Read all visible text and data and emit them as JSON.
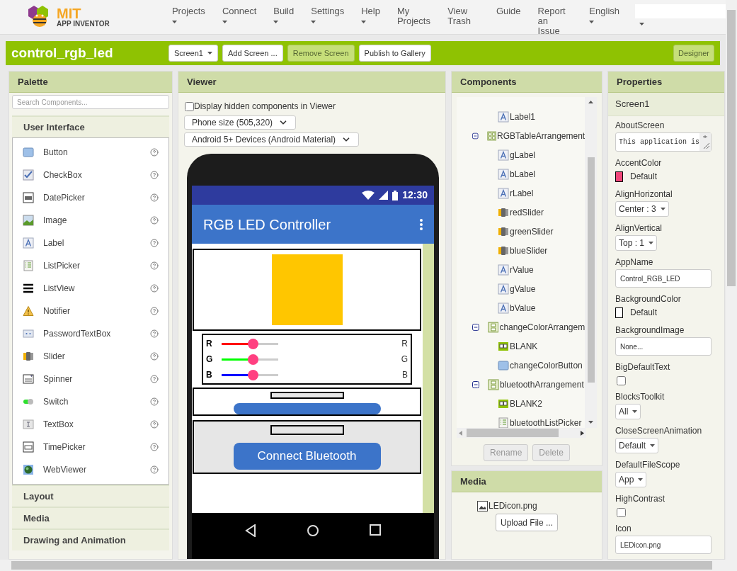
{
  "header": {
    "logo_title": "MIT",
    "logo_subtitle": "APP INVENTOR",
    "nav": [
      {
        "label": "Projects",
        "menu": true
      },
      {
        "label": "Connect",
        "menu": true
      },
      {
        "label": "Build",
        "menu": true
      },
      {
        "label": "Settings",
        "menu": true
      },
      {
        "label": "Help",
        "menu": true
      },
      {
        "label": "My Projects",
        "menu": false
      },
      {
        "label": "View Trash",
        "menu": false
      },
      {
        "label": "Guide",
        "menu": false
      },
      {
        "label": "Report an Issue",
        "menu": false
      },
      {
        "label": "English",
        "menu": true
      }
    ]
  },
  "toolbar": {
    "project": "control_rgb_led",
    "screen": "Screen1",
    "buttons": [
      {
        "label": "Add Screen ...",
        "disabled": false
      },
      {
        "label": "Remove Screen",
        "disabled": true
      },
      {
        "label": "Publish to Gallery",
        "disabled": false
      }
    ],
    "designer": {
      "label": "Designer",
      "selected": true
    }
  },
  "palette": {
    "title": "Palette",
    "search_placeholder": "Search Components...",
    "categories": [
      {
        "label": "User Interface",
        "items": [
          {
            "label": "Button",
            "kind": "button"
          },
          {
            "label": "CheckBox",
            "kind": "checkbox"
          },
          {
            "label": "DatePicker",
            "kind": "datepicker"
          },
          {
            "label": "Image",
            "kind": "image"
          },
          {
            "label": "Label",
            "kind": "label"
          },
          {
            "label": "ListPicker",
            "kind": "listpicker"
          },
          {
            "label": "ListView",
            "kind": "listview"
          },
          {
            "label": "Notifier",
            "kind": "notifier"
          },
          {
            "label": "PasswordTextBox",
            "kind": "password"
          },
          {
            "label": "Slider",
            "kind": "slider"
          },
          {
            "label": "Spinner",
            "kind": "spinner"
          },
          {
            "label": "Switch",
            "kind": "switch"
          },
          {
            "label": "TextBox",
            "kind": "textbox"
          },
          {
            "label": "TimePicker",
            "kind": "timepicker"
          },
          {
            "label": "WebViewer",
            "kind": "webviewer"
          }
        ]
      },
      {
        "label": "Layout"
      },
      {
        "label": "Media"
      },
      {
        "label": "Drawing and Animation"
      }
    ]
  },
  "viewer": {
    "title": "Viewer",
    "hidden_checkbox": {
      "label": "Display hidden components in Viewer",
      "checked": false
    },
    "selects": [
      "Phone size (505,320)",
      "Android 5+ Devices (Android Material)"
    ],
    "phone": {
      "time": "12:30",
      "app_title": "RGB LED Controller",
      "sliders": [
        {
          "label": "R",
          "value_label": "R",
          "color": "#ff0000",
          "level": 0.55
        },
        {
          "label": "G",
          "value_label": "G",
          "color": "#00ff00",
          "level": 0.55
        },
        {
          "label": "B",
          "value_label": "B",
          "color": "#0000ff",
          "level": 0.55
        }
      ],
      "bluetooth_button": "Connect Bluetooth"
    }
  },
  "components": {
    "title": "Components",
    "partial_children": [
      {
        "name": "Label1",
        "kind": "label"
      }
    ],
    "tree": [
      {
        "name": "RGBTableArrangement",
        "kind": "table",
        "expanded": true,
        "children": [
          {
            "name": "gLabel",
            "kind": "label"
          },
          {
            "name": "bLabel",
            "kind": "label"
          },
          {
            "name": "rLabel",
            "kind": "label"
          },
          {
            "name": "redSlider",
            "kind": "slider"
          },
          {
            "name": "greenSlider",
            "kind": "slider"
          },
          {
            "name": "blueSlider",
            "kind": "slider"
          },
          {
            "name": "rValue",
            "kind": "label"
          },
          {
            "name": "gValue",
            "kind": "label"
          },
          {
            "name": "bValue",
            "kind": "label"
          }
        ]
      },
      {
        "name": "changeColorArrangem",
        "kind": "vertical",
        "expanded": true,
        "children": [
          {
            "name": "BLANK",
            "kind": "blank"
          },
          {
            "name": "changeColorButton",
            "kind": "button"
          }
        ]
      },
      {
        "name": "bluetoothArrangement",
        "kind": "vertical",
        "expanded": true,
        "children": [
          {
            "name": "BLANK2",
            "kind": "blank"
          },
          {
            "name": "bluetoothListPicker",
            "kind": "listpicker"
          }
        ]
      }
    ],
    "buttons": [
      {
        "label": "Rename",
        "disabled": true
      },
      {
        "label": "Delete",
        "disabled": true
      }
    ]
  },
  "media": {
    "title": "Media",
    "files": [
      {
        "name": "LEDicon.png"
      }
    ],
    "upload": "Upload File ..."
  },
  "properties": {
    "title": "Properties",
    "component": "Screen1",
    "items": [
      {
        "label": "AboutScreen",
        "kind": "textarea",
        "value": "This application is"
      },
      {
        "label": "AccentColor",
        "kind": "color",
        "color": "#f0467a",
        "value": "Default"
      },
      {
        "label": "AlignHorizontal",
        "kind": "dropdown",
        "value": "Center : 3"
      },
      {
        "label": "AlignVertical",
        "kind": "dropdown",
        "value": "Top : 1"
      },
      {
        "label": "AppName",
        "kind": "text",
        "value": "Control_RGB_LED"
      },
      {
        "label": "BackgroundColor",
        "kind": "color",
        "color": "#ffffff",
        "value": "Default"
      },
      {
        "label": "BackgroundImage",
        "kind": "text",
        "value": "None..."
      },
      {
        "label": "BigDefaultText",
        "kind": "checkbox",
        "checked": false
      },
      {
        "label": "BlocksToolkit",
        "kind": "dropdown",
        "value": "All"
      },
      {
        "label": "CloseScreenAnimation",
        "kind": "dropdown",
        "value": "Default"
      },
      {
        "label": "DefaultFileScope",
        "kind": "dropdown",
        "value": "App"
      },
      {
        "label": "HighContrast",
        "kind": "checkbox",
        "checked": false
      },
      {
        "label": "Icon",
        "kind": "text",
        "value": "LEDicon.png"
      }
    ]
  }
}
